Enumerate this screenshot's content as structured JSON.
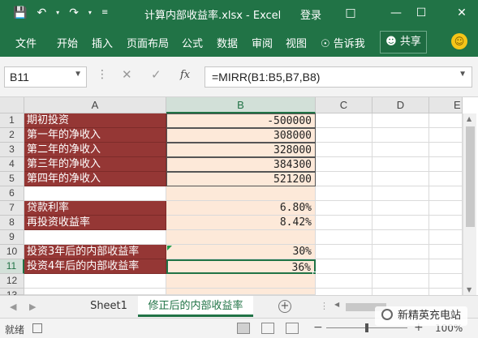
{
  "window": {
    "title": "计算内部收益率.xlsx - Excel",
    "login": "登录",
    "qat_icons": [
      "save-icon",
      "undo-icon",
      "redo-icon",
      "customize-qat-icon"
    ],
    "controls": [
      "restore-ribbon-icon",
      "minimize-icon",
      "maximize-icon",
      "close-icon"
    ]
  },
  "ribbon": {
    "tabs": [
      "文件",
      "开始",
      "插入",
      "页面布局",
      "公式",
      "数据",
      "审阅",
      "视图"
    ],
    "tell_me": "告诉我",
    "share": "共享"
  },
  "formula_bar": {
    "name_box": "B11",
    "formula": "=MIRR(B1:B5,B7,B8)",
    "fx": "fx"
  },
  "grid": {
    "columns": [
      "A",
      "B",
      "C",
      "D",
      "E"
    ],
    "rows": [
      "1",
      "2",
      "3",
      "4",
      "5",
      "6",
      "7",
      "8",
      "9",
      "10",
      "11",
      "12",
      "13"
    ],
    "cells": {
      "A1": "期初投资",
      "B1": "-500000",
      "A2": "第一年的净收入",
      "B2": "308000",
      "A3": "第二年的净收入",
      "B3": "328000",
      "A4": "第三年的净收入",
      "B4": "384300",
      "A5": "第四年的净收入",
      "B5": "521200",
      "A7": "贷款利率",
      "B7": "6.80%",
      "A8": "再投资收益率",
      "B8": "8.42%",
      "A10": "投资3年后的内部收益率",
      "B10": "30%",
      "A11": "投资4年后的内部收益率",
      "B11": "36%"
    },
    "colors": {
      "label_bg": "#953735",
      "value_bg": "#fde9d9",
      "accent": "#217346"
    }
  },
  "sheets": {
    "tabs": [
      "Sheet1",
      "修正后的内部收益率"
    ],
    "active_index": 1
  },
  "status": {
    "ready": "就绪",
    "zoom": "100%"
  },
  "watermark": "新精英充电站"
}
